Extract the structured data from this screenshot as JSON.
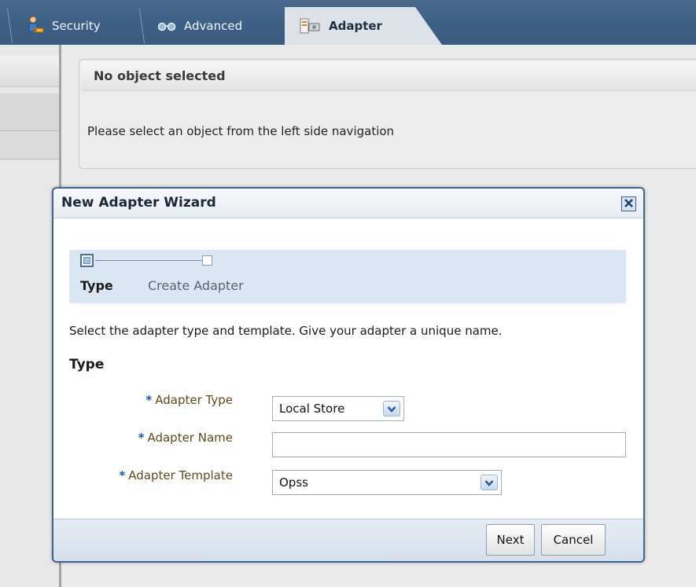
{
  "tabs": [
    {
      "label": "Security",
      "icon": "security-user-icon",
      "active": false
    },
    {
      "label": "Advanced",
      "icon": "glasses-icon",
      "active": false
    },
    {
      "label": "Adapter",
      "icon": "adapter-icon",
      "active": true
    }
  ],
  "content_panel": {
    "header": "No object selected",
    "message": "Please select an object from the left side navigation"
  },
  "dialog": {
    "title": "New Adapter Wizard",
    "train": {
      "steps": [
        {
          "label": "Type",
          "current": true
        },
        {
          "label": "Create Adapter",
          "current": false
        }
      ]
    },
    "instructions": "Select the adapter type and template. Give your adapter a unique name.",
    "section_heading": "Type",
    "fields": {
      "required_marker": "*",
      "adapter_type": {
        "label": "Adapter Type",
        "value": "Local Store"
      },
      "adapter_name": {
        "label": "Adapter Name",
        "value": ""
      },
      "adapter_template": {
        "label": "Adapter Template",
        "value": "Opss"
      }
    },
    "buttons": {
      "next": "Next",
      "cancel": "Cancel"
    }
  },
  "colors": {
    "tabbar": "#3e5f85",
    "dialog_border": "#3e6490",
    "required_marker": "#1d5b96",
    "field_label": "#5b4a1b",
    "train_background": "#dbe6f4"
  }
}
